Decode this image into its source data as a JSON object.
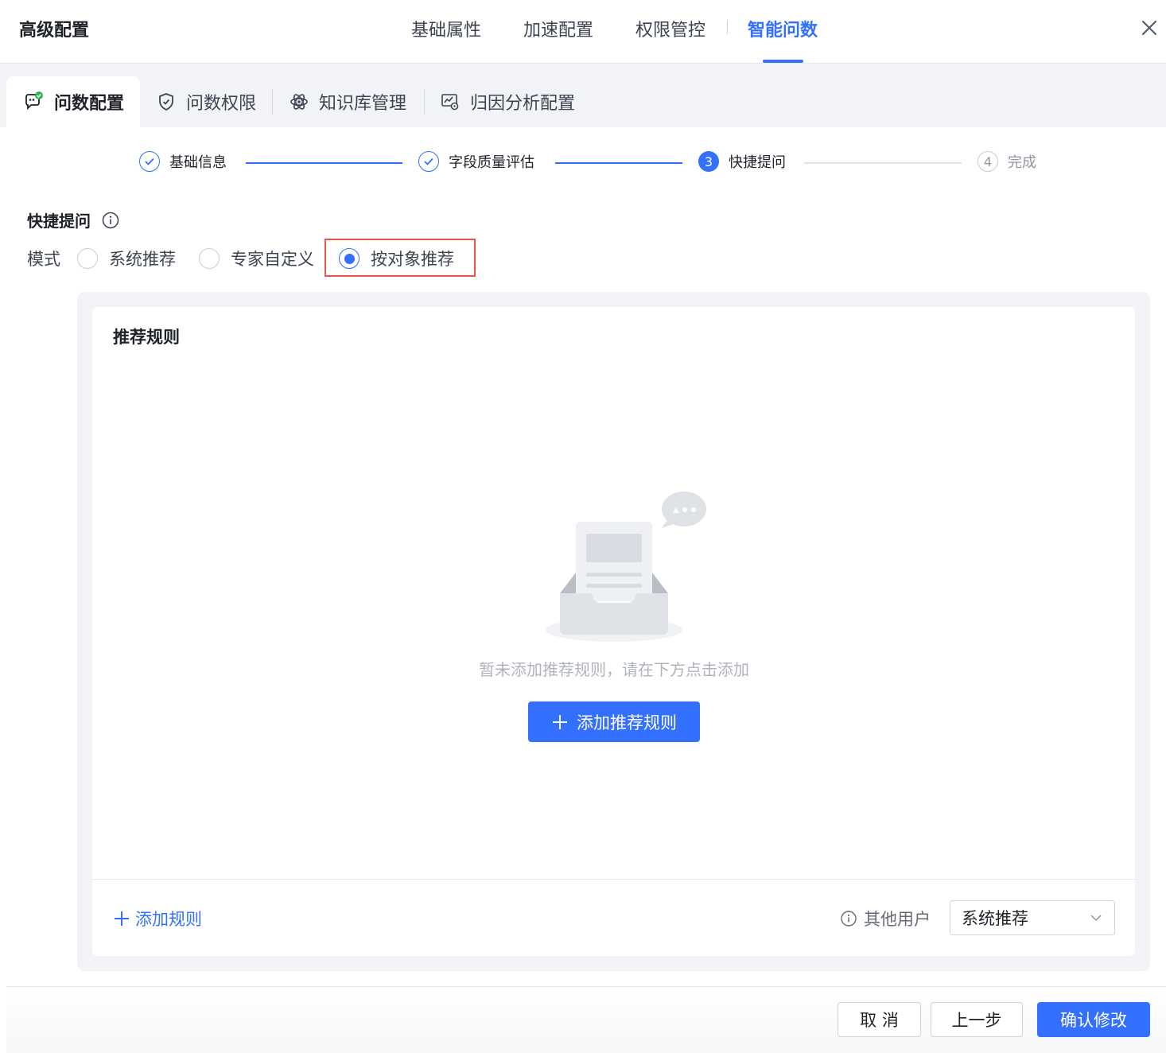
{
  "header": {
    "title": "高级配置",
    "tabs": [
      {
        "label": "基础属性"
      },
      {
        "label": "加速配置"
      },
      {
        "label": "权限管控"
      },
      {
        "label": "智能问数"
      }
    ],
    "active_tab": "智能问数"
  },
  "subtabs": [
    {
      "label": "问数配置",
      "icon": "chat-config-icon"
    },
    {
      "label": "问数权限",
      "icon": "shield-check-icon"
    },
    {
      "label": "知识库管理",
      "icon": "atom-icon"
    },
    {
      "label": "归因分析配置",
      "icon": "analysis-icon"
    }
  ],
  "steps": [
    {
      "label": "基础信息",
      "state": "done"
    },
    {
      "label": "字段质量评估",
      "state": "done"
    },
    {
      "label": "快捷提问",
      "state": "current",
      "number": "3"
    },
    {
      "label": "完成",
      "state": "todo",
      "number": "4"
    }
  ],
  "section": {
    "title": "快捷提问",
    "mode_label": "模式",
    "options": [
      {
        "label": "系统推荐",
        "checked": false
      },
      {
        "label": "专家自定义",
        "checked": false
      },
      {
        "label": "按对象推荐",
        "checked": true
      }
    ]
  },
  "rules": {
    "title": "推荐规则",
    "empty_text": "暂未添加推荐规则，请在下方点击添加",
    "add_rec_button": "添加推荐规则",
    "add_rule_link": "添加规则",
    "other_users_label": "其他用户",
    "other_users_select": "系统推荐"
  },
  "footer": {
    "cancel": "取 消",
    "prev": "上一步",
    "confirm": "确认修改"
  },
  "colors": {
    "accent": "#3370ff",
    "highlight": "#e8534a",
    "success": "#2db55d"
  }
}
